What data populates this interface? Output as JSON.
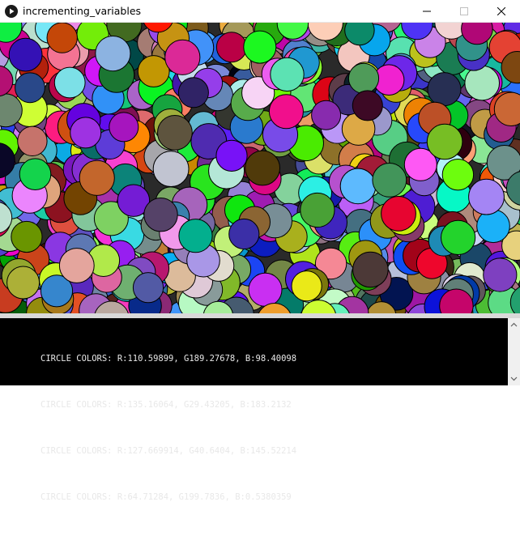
{
  "window": {
    "title": "incrementing_variables",
    "app_icon": "play-icon",
    "controls": {
      "minimize": "minimize-icon",
      "maximize": "maximize-icon",
      "close": "close-icon"
    }
  },
  "canvas": {
    "content": "random-colored-circles",
    "outline_color": "#000000"
  },
  "console": {
    "lines": [
      "CIRCLE COLORS: R:110.59899, G189.27678, B:98.40098",
      "CIRCLE COLORS: R:135.16064, G29.43205, B:183.2132",
      "CIRCLE COLORS: R:127.669914, G40.6404, B:145.52214",
      "CIRCLE COLORS: R:64.71284, G199.7836, B:0.5380359"
    ]
  }
}
